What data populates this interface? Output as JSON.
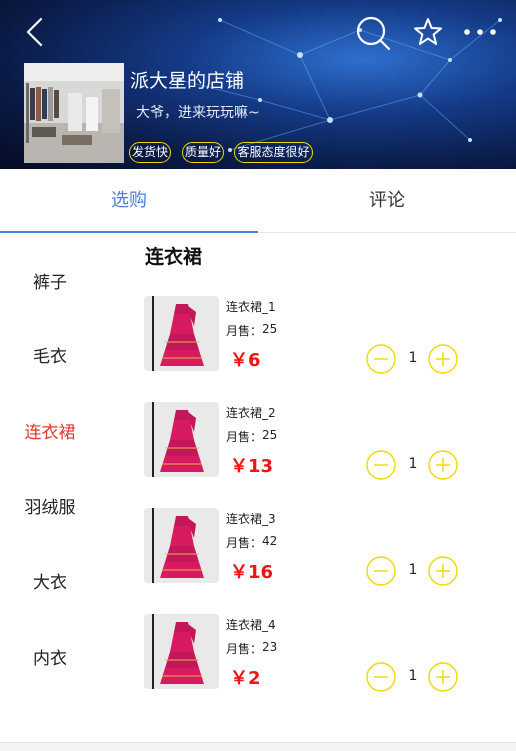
{
  "header": {
    "shop_name": "派大星的店铺",
    "slogan": "大爷，进来玩玩嘛~",
    "tags": [
      "发货快",
      "质量好",
      "客服态度很好"
    ],
    "icons": [
      "back-icon",
      "search-icon",
      "star-icon",
      "more-icon"
    ]
  },
  "tabs": [
    {
      "label": "选购",
      "active": true
    },
    {
      "label": "评论",
      "active": false
    }
  ],
  "categories": [
    {
      "label": "裤子",
      "active": false
    },
    {
      "label": "毛衣",
      "active": false
    },
    {
      "label": "连衣裙",
      "active": true
    },
    {
      "label": "羽绒服",
      "active": false
    },
    {
      "label": "大衣",
      "active": false
    },
    {
      "label": "内衣",
      "active": false
    }
  ],
  "section_title": "连衣裙",
  "sales_label": "月售：",
  "products": [
    {
      "name": "连衣裙_1",
      "sales": "25",
      "price": "￥6",
      "qty": "1"
    },
    {
      "name": "连衣裙_2",
      "sales": "25",
      "price": "￥13",
      "qty": "1"
    },
    {
      "name": "连衣裙_3",
      "sales": "42",
      "price": "￥16",
      "qty": "1"
    },
    {
      "name": "连衣裙_4",
      "sales": "23",
      "price": "￥2",
      "qty": "1"
    }
  ],
  "colors": {
    "accent_tab": "#4a7fd6",
    "active_category": "#e8342c",
    "price": "#f01414",
    "stepper": "#f0d800",
    "tag_border": "#f0d800"
  }
}
